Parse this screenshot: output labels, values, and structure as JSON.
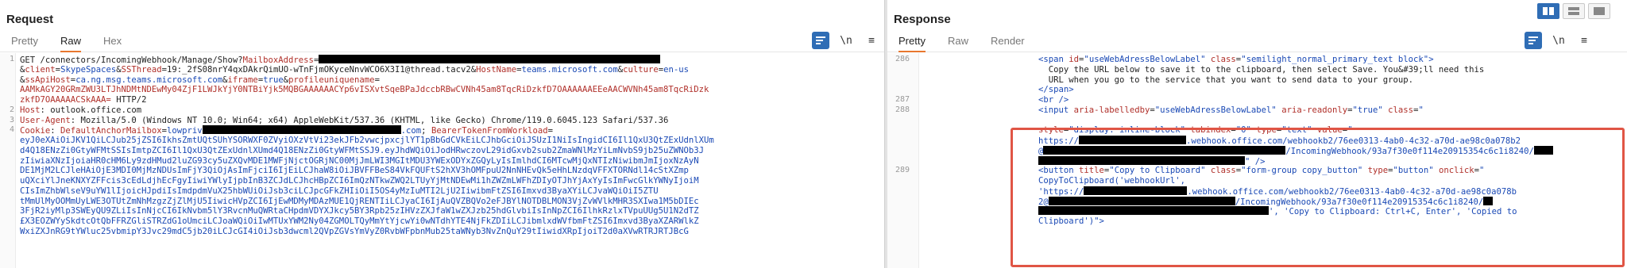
{
  "request": {
    "title": "Request",
    "tabs": [
      "Pretty",
      "Raw",
      "Hex"
    ],
    "active_tab": "Raw",
    "tool_wrap_icon": "wrap-icon",
    "tool_newline": "\\n",
    "tool_menu": "≡",
    "lines": [
      {
        "num": "1",
        "parts": [
          {
            "c": "",
            "t": "GET /connectors/IncomingWebhook/Manage/Show?"
          },
          {
            "c": "k",
            "t": "MailboxAddress"
          },
          {
            "c": "",
            "t": "="
          },
          {
            "c": "redact",
            "w": 430
          }
        ]
      },
      {
        "num": "",
        "parts": [
          {
            "c": "",
            "t": "&"
          },
          {
            "c": "k",
            "t": "client"
          },
          {
            "c": "",
            "t": "="
          },
          {
            "c": "v",
            "t": "SkypeSpaces"
          },
          {
            "c": "",
            "t": "&"
          },
          {
            "c": "k",
            "t": "SSThread"
          },
          {
            "c": "",
            "t": "=19:_2fS08nrY4qxDAkrQimUO-wTnFjmOKyceNnvWCO6X3I1@thread.tacv2&"
          },
          {
            "c": "k",
            "t": "HostName"
          },
          {
            "c": "",
            "t": "="
          },
          {
            "c": "v",
            "t": "teams.microsoft.com"
          },
          {
            "c": "",
            "t": "&"
          },
          {
            "c": "k",
            "t": "culture"
          },
          {
            "c": "",
            "t": "="
          },
          {
            "c": "v",
            "t": "en-us"
          }
        ]
      },
      {
        "num": "",
        "parts": [
          {
            "c": "",
            "t": "&"
          },
          {
            "c": "k",
            "t": "ssApiHost"
          },
          {
            "c": "",
            "t": "="
          },
          {
            "c": "v",
            "t": "ca.ng.msg.teams.microsoft.com"
          },
          {
            "c": "",
            "t": "&"
          },
          {
            "c": "k",
            "t": "iframe"
          },
          {
            "c": "",
            "t": "="
          },
          {
            "c": "v",
            "t": "true"
          },
          {
            "c": "",
            "t": "&"
          },
          {
            "c": "k",
            "t": "profileuniquename"
          },
          {
            "c": "",
            "t": "="
          }
        ]
      },
      {
        "num": "",
        "parts": [
          {
            "c": "red",
            "t": "AAMkAGY20GRmZWU3LTJhNDMtNDEwMy04ZjF1LWJkYjY0NTBiYjk5MQBGAAAAAACYp6vISXvtSqeBPaJdccbRBwCVNh45am8TqcRiDzkfD7OAAAAAAEEeAACWVNh45am8TqcRiDzk"
          }
        ]
      },
      {
        "num": "",
        "parts": [
          {
            "c": "red",
            "t": "zkfD7OAAAAACSkAAA="
          },
          {
            "c": "",
            "t": " HTTP/2"
          }
        ]
      },
      {
        "num": "2",
        "parts": [
          {
            "c": "k",
            "t": "Host"
          },
          {
            "c": "",
            "t": ": outlook.office.com"
          }
        ]
      },
      {
        "num": "3",
        "parts": [
          {
            "c": "k",
            "t": "User-Agent"
          },
          {
            "c": "",
            "t": ": Mozilla/5.0 (Windows NT 10.0; Win64; x64) AppleWebKit/537.36 (KHTML, like Gecko) Chrome/119.0.6045.123 Safari/537.36"
          }
        ]
      },
      {
        "num": "4",
        "parts": [
          {
            "c": "k",
            "t": "Cookie"
          },
          {
            "c": "",
            "t": ": "
          },
          {
            "c": "k",
            "t": "DefaultAnchorMailbox"
          },
          {
            "c": "",
            "t": "="
          },
          {
            "c": "v",
            "t": "lowpriv"
          },
          {
            "c": "redact",
            "w": 250
          },
          {
            "c": "v",
            "t": ".com"
          },
          {
            "c": "",
            "t": "; "
          },
          {
            "c": "k",
            "t": "BearerTokenFromWorkload"
          },
          {
            "c": "",
            "t": "="
          }
        ]
      },
      {
        "num": "",
        "parts": [
          {
            "c": "v",
            "t": "eyJ0eXAiOiJKV1QiLCJub25jZSI6IkhsZmtUQtSUhYSORWXF0ZVyiOXzVtVi23ekJFb2vwcjpxcjlYT1pBbGdCVkEiLCJhbGciOiJSUzI1NiIsIngidCI6Il1QxU3QtZExUdnlXUm"
          }
        ]
      },
      {
        "num": "",
        "parts": [
          {
            "c": "v",
            "t": "d4Q18ENzZi0GtyWFMtSSIsImtpZCI6Il1QxU3QtZExUdnlXUmd4Q18ENzZi0GtyWFMtSSJ9.eyJhdWQiOiJodHRwczovL29idGxvb2sub2ZmaWNlMzYiLmNvbS9jb25uZWNOb3J"
          }
        ]
      },
      {
        "num": "",
        "parts": [
          {
            "c": "v",
            "t": "zIiwiaXNzIjoiaHR0cHM6Ly9zdHMud2luZG93cy5uZXQvMDE1MWFjNjctOGRjNC00MjJmLWI3MGItMDU3YWExODYxZGQyLyIsImlhdCI6MTcwMjQxNTIzNiwibmJmIjoxNzAyN"
          }
        ]
      },
      {
        "num": "",
        "parts": [
          {
            "c": "v",
            "t": "DE1MjM2LCJleHAiOjE3MDI0MjMzNDUsImFjY3QiOjAsImFjciI6IjEiLCJhaW8iOiJBVFFBeS84VkFQUFtS2hXV3hOMFpuU2NnNHEvQk5eHhLNzdqVFFXTORNdl14cStXZmp"
          }
        ]
      },
      {
        "num": "",
        "parts": [
          {
            "c": "v",
            "t": "uQXciYlJneKNXYZFFcis3cEdLdjhEcFgyIiwiYWlyIjpbInB3ZCJdLCJhcHBpZCI6ImQzNTkwZWQ2LTUyYjMtNDEwMi1hZWZmLWFhZDIyOTJhYjAxYyIsImFwcGlkYWNyIjoiM"
          }
        ]
      },
      {
        "num": "",
        "parts": [
          {
            "c": "v",
            "t": "CIsImZhbWlseV9uYW1lIjoicHJpdiIsImdpdmVuX25hbWUiOiJsb3ciLCJpcGFkZHIiOiI5OS4yMzIuMTI2LjU2IiwibmFtZSI6Imxvd3ByaXYiLCJvaWQiOiI5ZTU"
          }
        ]
      },
      {
        "num": "",
        "parts": [
          {
            "c": "v",
            "t": "tMmUlMyOOMmUyLWE3OTUtZmNhMzgzZjZlMjU5IiwicHVpZCI6IjEwMDMyMDAzMUE1QjRENTIiLCJyaCI6IjAuQVZBQVo2eFJBYlNOTDBLMON3VjZvWVlkMHR3SXIwa1M5bDIEc"
          }
        ]
      },
      {
        "num": "",
        "parts": [
          {
            "c": "v",
            "t": "3FjR2iyMlp3SWEyQU9ZLiIsInNjcCI6IkNvbm5lY3RvcnMuQWRtaCHpdmVDYXJkcy5BY3Rpb25zIHVzZXJfaW1wZXJzb25hdGlvbiIsInNpZCI6IlhkRzlxTVpuUUg5U1N2dTZ"
          }
        ]
      },
      {
        "num": "",
        "parts": [
          {
            "c": "v",
            "t": "£X3EOZWYySkdtcOtQbFFRZGliSTRZdG1oUmciLCJoaWQiOiIwMTUxYWM2Ny04ZGMOLTQyMmYtYjcwYi0wNTdhYTE4NjFkZDIiLCJibmlxdWVfbmFtZSI6Imxvd3ByaXZARWlkZ"
          }
        ]
      },
      {
        "num": "",
        "parts": [
          {
            "c": "v",
            "t": "WxiZXJnRG9tYWluc25vbmipY3Jvc29mdC5jb20iLCJcGI4iOiJsb3dwcml2QVpZGVsYmVyZ0RvbWFpbnMub25taWNyb3NvZnQuY29tIiwidXRpIjoiT2d0aXVwRTRJRTJBcG"
          }
        ]
      }
    ]
  },
  "response": {
    "title": "Response",
    "tabs": [
      "Pretty",
      "Raw",
      "Render"
    ],
    "active_tab": "Pretty",
    "tool_newline": "\\n",
    "tool_menu": "≡",
    "lines": [
      {
        "num": "286",
        "parts": [
          {
            "c": "t",
            "t": "<span "
          },
          {
            "c": "a",
            "t": "id"
          },
          {
            "c": "",
            "t": "="
          },
          {
            "c": "b",
            "t": "\"useWebAdressBelowLabel\""
          },
          {
            "c": "",
            "t": " "
          },
          {
            "c": "a",
            "t": "class"
          },
          {
            "c": "",
            "t": "="
          },
          {
            "c": "b",
            "t": "\"semilight_normal_primary_text block\""
          },
          {
            "c": "t",
            "t": ">"
          }
        ]
      },
      {
        "num": "",
        "parts": [
          {
            "c": "",
            "t": "  Copy the URL below to save it to the clipboard, then select Save. You&#39;ll need this"
          }
        ]
      },
      {
        "num": "",
        "parts": [
          {
            "c": "",
            "t": "  URL when you go to the service that you want to send data to your group."
          }
        ]
      },
      {
        "num": "",
        "parts": [
          {
            "c": "t",
            "t": "</span>"
          }
        ]
      },
      {
        "num": "287",
        "parts": [
          {
            "c": "t",
            "t": "<br />"
          }
        ]
      },
      {
        "num": "288",
        "parts": [
          {
            "c": "t",
            "t": "<input "
          },
          {
            "c": "a",
            "t": "aria-labelledby"
          },
          {
            "c": "",
            "t": "="
          },
          {
            "c": "b",
            "t": "\"useWebAdressBelowLabel\""
          },
          {
            "c": "",
            "t": " "
          },
          {
            "c": "a",
            "t": "aria-readonly"
          },
          {
            "c": "",
            "t": "="
          },
          {
            "c": "b",
            "t": "\"true\""
          },
          {
            "c": "",
            "t": " "
          },
          {
            "c": "a",
            "t": "class"
          },
          {
            "c": "",
            "t": "="
          },
          {
            "c": "b",
            "t": "\""
          }
        ]
      },
      {
        "num": "",
        "parts": [
          {
            "c": "b",
            "t": ""
          }
        ]
      },
      {
        "num": "",
        "parts": [
          {
            "c": "a",
            "t": "style"
          },
          {
            "c": "",
            "t": "="
          },
          {
            "c": "b",
            "t": "\"display: inline-block\""
          },
          {
            "c": "",
            "t": " "
          },
          {
            "c": "a",
            "t": "tabindex"
          },
          {
            "c": "",
            "t": "="
          },
          {
            "c": "b",
            "t": "\"0\""
          },
          {
            "c": "",
            "t": " "
          },
          {
            "c": "a",
            "t": "type"
          },
          {
            "c": "",
            "t": "="
          },
          {
            "c": "b",
            "t": "\"text\""
          },
          {
            "c": "",
            "t": " "
          },
          {
            "c": "a",
            "t": "value"
          },
          {
            "c": "",
            "t": "="
          },
          {
            "c": "b",
            "t": "\""
          }
        ]
      },
      {
        "num": "",
        "parts": [
          {
            "c": "b",
            "t": "https://"
          },
          {
            "c": "redact",
            "w": 135
          },
          {
            "c": "b",
            "t": ".webhook.office.com/webhookb2/76ee0313-4ab0-4c32-a70d-ae98c0a078b2"
          }
        ]
      },
      {
        "num": "",
        "parts": [
          {
            "c": "b",
            "t": "@"
          },
          {
            "c": "redact",
            "w": 305
          },
          {
            "c": "b",
            "t": "/IncomingWebhook/93a7f30e0f114e20915354c6c1i8240/"
          },
          {
            "c": "redact",
            "w": 24
          }
        ]
      },
      {
        "num": "",
        "parts": [
          {
            "c": "redact",
            "w": 260
          },
          {
            "c": "b",
            "t": "\""
          },
          {
            "c": "t",
            "t": " />"
          }
        ]
      },
      {
        "num": "289",
        "parts": [
          {
            "c": "t",
            "t": "<button "
          },
          {
            "c": "a",
            "t": "title"
          },
          {
            "c": "",
            "t": "="
          },
          {
            "c": "b",
            "t": "\"Copy to Clipboard\""
          },
          {
            "c": "",
            "t": " "
          },
          {
            "c": "a",
            "t": "class"
          },
          {
            "c": "",
            "t": "="
          },
          {
            "c": "b",
            "t": "\"form-group copy_button\""
          },
          {
            "c": "",
            "t": " "
          },
          {
            "c": "a",
            "t": "type"
          },
          {
            "c": "",
            "t": "="
          },
          {
            "c": "b",
            "t": "\"button\""
          },
          {
            "c": "",
            "t": " "
          },
          {
            "c": "a",
            "t": "onclick"
          },
          {
            "c": "",
            "t": "="
          },
          {
            "c": "b",
            "t": "\""
          }
        ]
      },
      {
        "num": "",
        "parts": [
          {
            "c": "b",
            "t": "CopyToClipboard('webhookUrl',"
          }
        ]
      },
      {
        "num": "",
        "parts": [
          {
            "c": "b",
            "t": "'https://"
          },
          {
            "c": "redact",
            "w": 130
          },
          {
            "c": "b",
            "t": ".webhook.office.com/webhookb2/76ee0313-4ab0-4c32-a70d-ae98c0a078b"
          }
        ]
      },
      {
        "num": "",
        "parts": [
          {
            "c": "b",
            "t": "2@"
          },
          {
            "c": "redact",
            "w": 235
          },
          {
            "c": "b",
            "t": "/IncomingWebhook/93a7f30e0f114e20915354c6c1i8240/"
          },
          {
            "c": "redact",
            "w": 12
          }
        ]
      },
      {
        "num": "",
        "parts": [
          {
            "c": "redact",
            "w": 290
          },
          {
            "c": "b",
            "t": "', 'Copy to Clipboard: Ctrl+C, Enter', 'Copied to"
          }
        ]
      },
      {
        "num": "",
        "parts": [
          {
            "c": "b",
            "t": "Clipboard')\""
          },
          {
            "c": "t",
            "t": ">"
          }
        ]
      }
    ]
  },
  "layout_buttons": [
    "split-horizontal-icon",
    "split-vertical-icon",
    "single-pane-icon"
  ],
  "colors": {
    "accent_tab": "#e8772e",
    "highlight_box": "#e05545",
    "key": "#b0302a",
    "value": "#1a49b5",
    "button_on": "#2f6db5"
  }
}
